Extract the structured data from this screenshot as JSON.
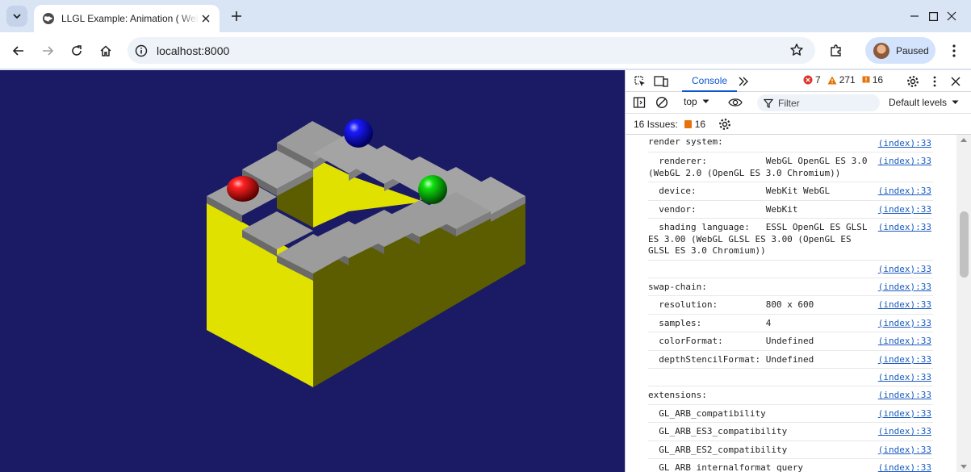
{
  "browser": {
    "tab_title": "LLGL Example: Animation ( WebGL )",
    "url": "localhost:8000",
    "profile_label": "Paused"
  },
  "devtools": {
    "active_tab": "Console",
    "errors_count": "7",
    "warnings_count": "271",
    "issues_count_badge": "16",
    "context": "top",
    "filter_placeholder": "Filter",
    "levels_label": "Default levels",
    "issues_label": "16 Issues:",
    "issues_count": "16",
    "console_lines": [
      {
        "text": "render system:",
        "source": "(index):33"
      },
      {
        "text": "  renderer:           WebGL OpenGL ES 3.0 (WebGL 2.0 (OpenGL ES 3.0 Chromium))",
        "source": "(index):33"
      },
      {
        "text": "  device:             WebKit WebGL",
        "source": "(index):33"
      },
      {
        "text": "  vendor:             WebKit",
        "source": "(index):33"
      },
      {
        "text": "  shading language:   ESSL OpenGL ES GLSL ES 3.00 (WebGL GLSL ES 3.00 (OpenGL ES GLSL ES 3.0 Chromium))",
        "source": "(index):33"
      },
      {
        "text": "",
        "source": "(index):33"
      },
      {
        "text": "swap-chain:",
        "source": "(index):33"
      },
      {
        "text": "  resolution:         800 x 600",
        "source": "(index):33"
      },
      {
        "text": "  samples:            4",
        "source": "(index):33"
      },
      {
        "text": "  colorFormat:        Undefined",
        "source": "(index):33"
      },
      {
        "text": "  depthStencilFormat: Undefined",
        "source": "(index):33"
      },
      {
        "text": "",
        "source": "(index):33"
      },
      {
        "text": "extensions:",
        "source": "(index):33"
      },
      {
        "text": "  GL_ARB_compatibility",
        "source": "(index):33"
      },
      {
        "text": "  GL_ARB_ES3_compatibility",
        "source": "(index):33"
      },
      {
        "text": "  GL_ARB_ES2_compatibility",
        "source": "(index):33"
      },
      {
        "text": "  GL_ARB_internalformat_query",
        "source": "(index):33"
      }
    ]
  },
  "scene": {
    "background": "#1b1a65",
    "wall_color": "#e1e100",
    "wall_shade": "#5c5c00",
    "stair_color": "#9c9c9c",
    "balls": [
      "red",
      "blue",
      "green"
    ]
  }
}
